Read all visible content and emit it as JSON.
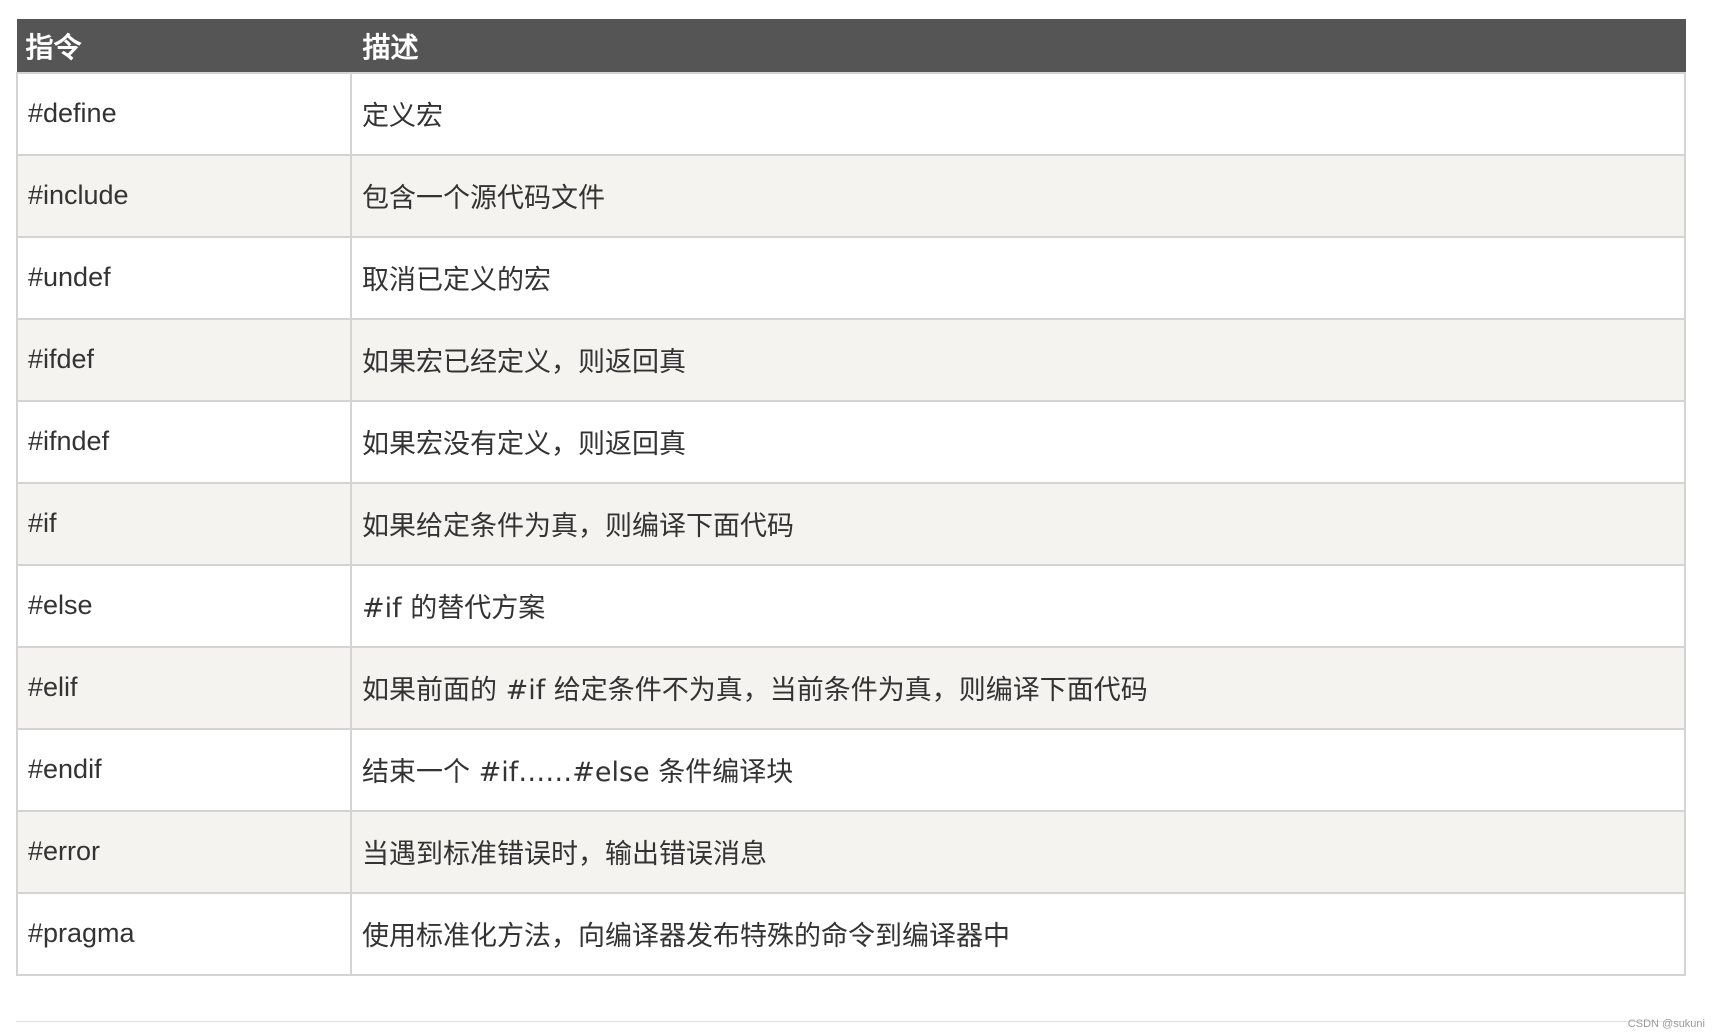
{
  "table": {
    "headers": {
      "directive": "指令",
      "description": "描述"
    },
    "rows": [
      {
        "directive": "#define",
        "description": "定义宏"
      },
      {
        "directive": "#include",
        "description": "包含一个源代码文件"
      },
      {
        "directive": "#undef",
        "description": "取消已定义的宏"
      },
      {
        "directive": "#ifdef",
        "description": "如果宏已经定义，则返回真"
      },
      {
        "directive": "#ifndef",
        "description": "如果宏没有定义，则返回真"
      },
      {
        "directive": "#if",
        "description": "如果给定条件为真，则编译下面代码"
      },
      {
        "directive": "#else",
        "description": "#if 的替代方案"
      },
      {
        "directive": "#elif",
        "description": "如果前面的 #if 给定条件不为真，当前条件为真，则编译下面代码"
      },
      {
        "directive": "#endif",
        "description": "结束一个 #if……#else 条件编译块"
      },
      {
        "directive": "#error",
        "description": "当遇到标准错误时，输出错误消息"
      },
      {
        "directive": "#pragma",
        "description": "使用标准化方法，向编译器发布特殊的命令到编译器中"
      }
    ]
  },
  "watermark": "CSDN @sukuni",
  "colors": {
    "header_bg": "#555555",
    "header_text": "#ffffff",
    "row_alt_bg": "#f4f3f0",
    "border": "#d4d4d4"
  }
}
